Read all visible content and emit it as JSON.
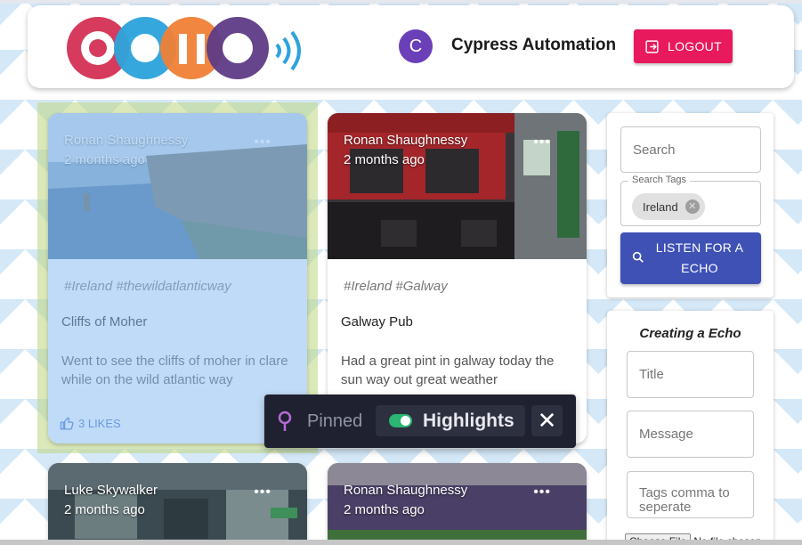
{
  "header": {
    "logo_letters": [
      "e",
      "c",
      "h",
      "o"
    ],
    "logo_colors": [
      "#d63a5c",
      "#2ea3dc",
      "#f07f37",
      "#5e3b86"
    ],
    "avatar_initial": "C",
    "avatar_color": "#6b3fb8",
    "username": "Cypress Automation",
    "logout_label": "LOGOUT",
    "logout_color": "#e8195d"
  },
  "cards": [
    {
      "author": "Ronan Shaughnessy",
      "time": "2 months ago",
      "more_icon": "more-dots-icon",
      "tags": "#Ireland #thewildatlanticway",
      "title": "Cliffs of Moher",
      "message": "Went to see the cliffs of moher in clare while on the wild atlantic way",
      "likes": "3 LIKES",
      "image": "sea-cliffs",
      "highlighted": true
    },
    {
      "author": "Ronan Shaughnessy",
      "time": "2 months ago",
      "more_icon": "more-dots-icon",
      "tags": "#Ireland #Galway",
      "title": "Galway Pub",
      "message": "Had a great pint in galway today the sun way out great weather",
      "image": "pub-storefront",
      "highlighted": false
    },
    {
      "author": "Luke Skywalker",
      "time": "2 months ago",
      "more_icon": "more-dots-icon",
      "image": "train-station"
    },
    {
      "author": "Ronan Shaughnessy",
      "time": "2 months ago",
      "more_icon": "more-dots-icon",
      "image": "stadium-crowd"
    }
  ],
  "search": {
    "placeholder": "Search",
    "tags_label": "Search Tags",
    "tag_chip": "Ireland",
    "listen_label": "LISTEN FOR A ECHO",
    "listen_color": "#3f51b5"
  },
  "create": {
    "heading": "Creating a Echo",
    "title_placeholder": "Title",
    "message_placeholder": "Message",
    "tags_placeholder": "Tags comma to seperate",
    "file_button": "Choose File",
    "file_status": "No file chosen"
  },
  "toolbar": {
    "pinned_label": "Pinned",
    "highlights_label": "Highlights",
    "highlights_on": true,
    "close_icon": "close-icon"
  }
}
